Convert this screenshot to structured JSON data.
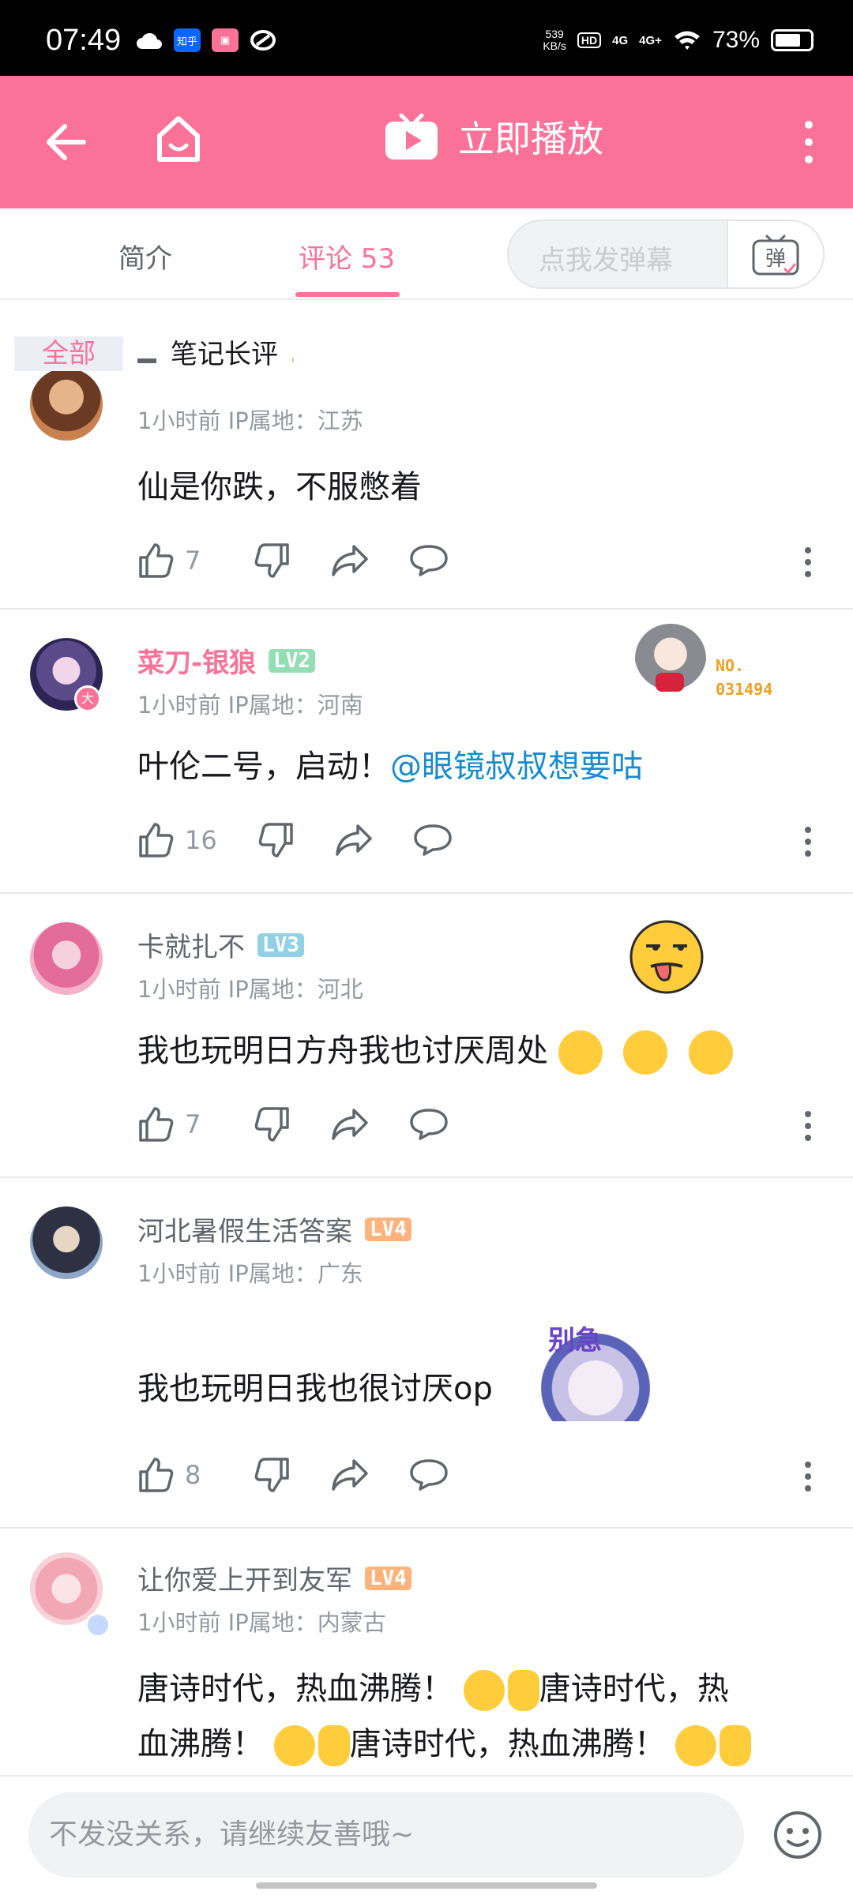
{
  "status_bar": {
    "time": "07:49",
    "net_speed": "539",
    "net_unit": "KB/s",
    "hd": "HD",
    "net1": "4G",
    "net2": "4G+",
    "battery": "73%",
    "battery_level": 0.73
  },
  "header": {
    "play_label": "立即播放"
  },
  "tabs": {
    "intro": "简介",
    "comments": "评论 53",
    "danmaku_placeholder": "点我发弹幕",
    "danmaku_btn": "弹"
  },
  "filter": {
    "all": "全部",
    "notes": "笔记长评"
  },
  "comments": [
    {
      "meta": "1小时前  IP属地：江苏",
      "text": "仙是你跌，不服憋着",
      "likes": "7"
    },
    {
      "user": "菜刀-银狼",
      "level": "LV2",
      "meta": "1小时前  IP属地：河南",
      "text": "叶伦二号，启动！",
      "mention": "@眼镜叔叔想要咕",
      "likes": "16",
      "badge_no": "NO.",
      "badge_num": "031494"
    },
    {
      "user": "卡就扎不",
      "level": "LV3",
      "meta": "1小时前  IP属地：河北",
      "text": "我也玩明日方舟我也讨厌周处",
      "likes": "7"
    },
    {
      "user": "河北暑假生活答案",
      "level": "LV4",
      "meta": "1小时前  IP属地：广东",
      "text": "我也玩明日我也很讨厌op",
      "sticker_text": "别急",
      "likes": "8"
    },
    {
      "user": "让你爱上开到友军",
      "level": "LV4",
      "meta": "1小时前  IP属地：内蒙古",
      "line1": "唐诗时代，热血沸腾！",
      "line1b": "唐诗时代，热",
      "line2": "血沸腾！",
      "line2b": "唐诗时代，热血沸腾！"
    }
  ],
  "bottom": {
    "reply_placeholder": "不发没关系，请继续友善哦~"
  },
  "colors": {
    "brand_pink": "#fb7299",
    "mention_blue": "#178bcf",
    "lv2": "#95ddb2",
    "lv3": "#92d1e5",
    "lv4": "#ffb37c"
  }
}
